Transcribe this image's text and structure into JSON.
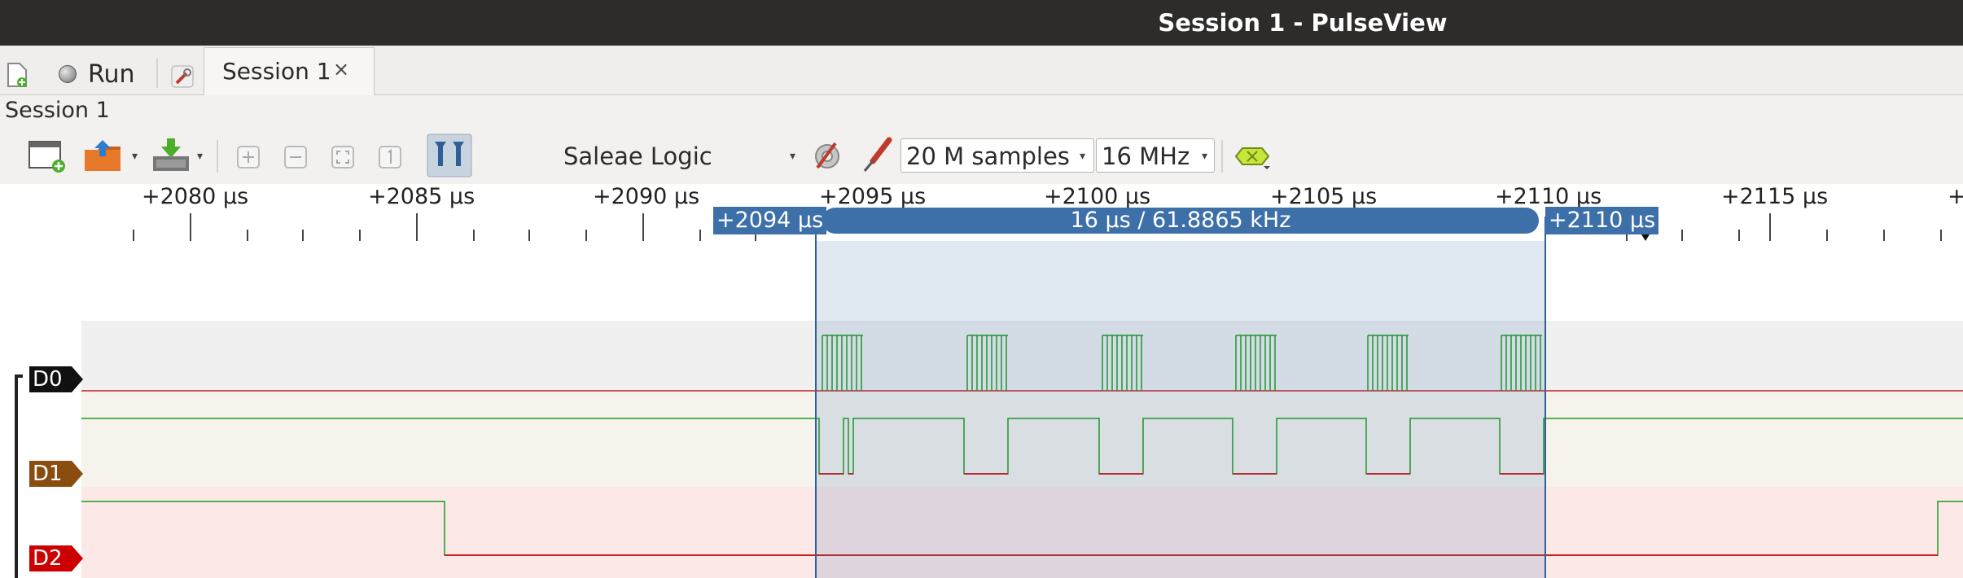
{
  "window": {
    "title": "Session 1 - PulseView"
  },
  "tabbar": {
    "new_session_icon": "new-session-icon",
    "run_label": "Run",
    "settings_icon": "wrench-icon",
    "tab_label": "Session 1",
    "tab_close": "×"
  },
  "session_label": "Session 1",
  "toolbar": {
    "device": "Saleae Logic",
    "samples": "20 M samples",
    "samplerate": "16 MHz",
    "icons": [
      "new-view-icon",
      "open-icon",
      "save-icon",
      "zoom-in-icon",
      "zoom-out-icon",
      "zoom-fit-icon",
      "zoom-one-to-one-icon",
      "cursor-toggle-icon",
      "device-config-icon",
      "probe-icon",
      "decoder-icon"
    ]
  },
  "ruler": {
    "labels": [
      "+2080 µs",
      "+2085 µs",
      "+2090 µs",
      "+2095 µs",
      "+2100 µs",
      "+2105 µs",
      "+2110 µs",
      "+2115 µs",
      "+"
    ]
  },
  "cursors": {
    "left_label": "+2094 µs",
    "right_label": "+2110 µs",
    "span_label": "16 µs / 61.8865 kHz"
  },
  "channels": [
    {
      "name": "D0",
      "color": "#000000"
    },
    {
      "name": "D1",
      "color": "#8a4d0f"
    },
    {
      "name": "D2",
      "color": "#cc0000"
    }
  ],
  "colors": {
    "selection": "#3d6fa8",
    "high_trace": "#1a9b1a",
    "low_trace": "#c81e1e"
  }
}
